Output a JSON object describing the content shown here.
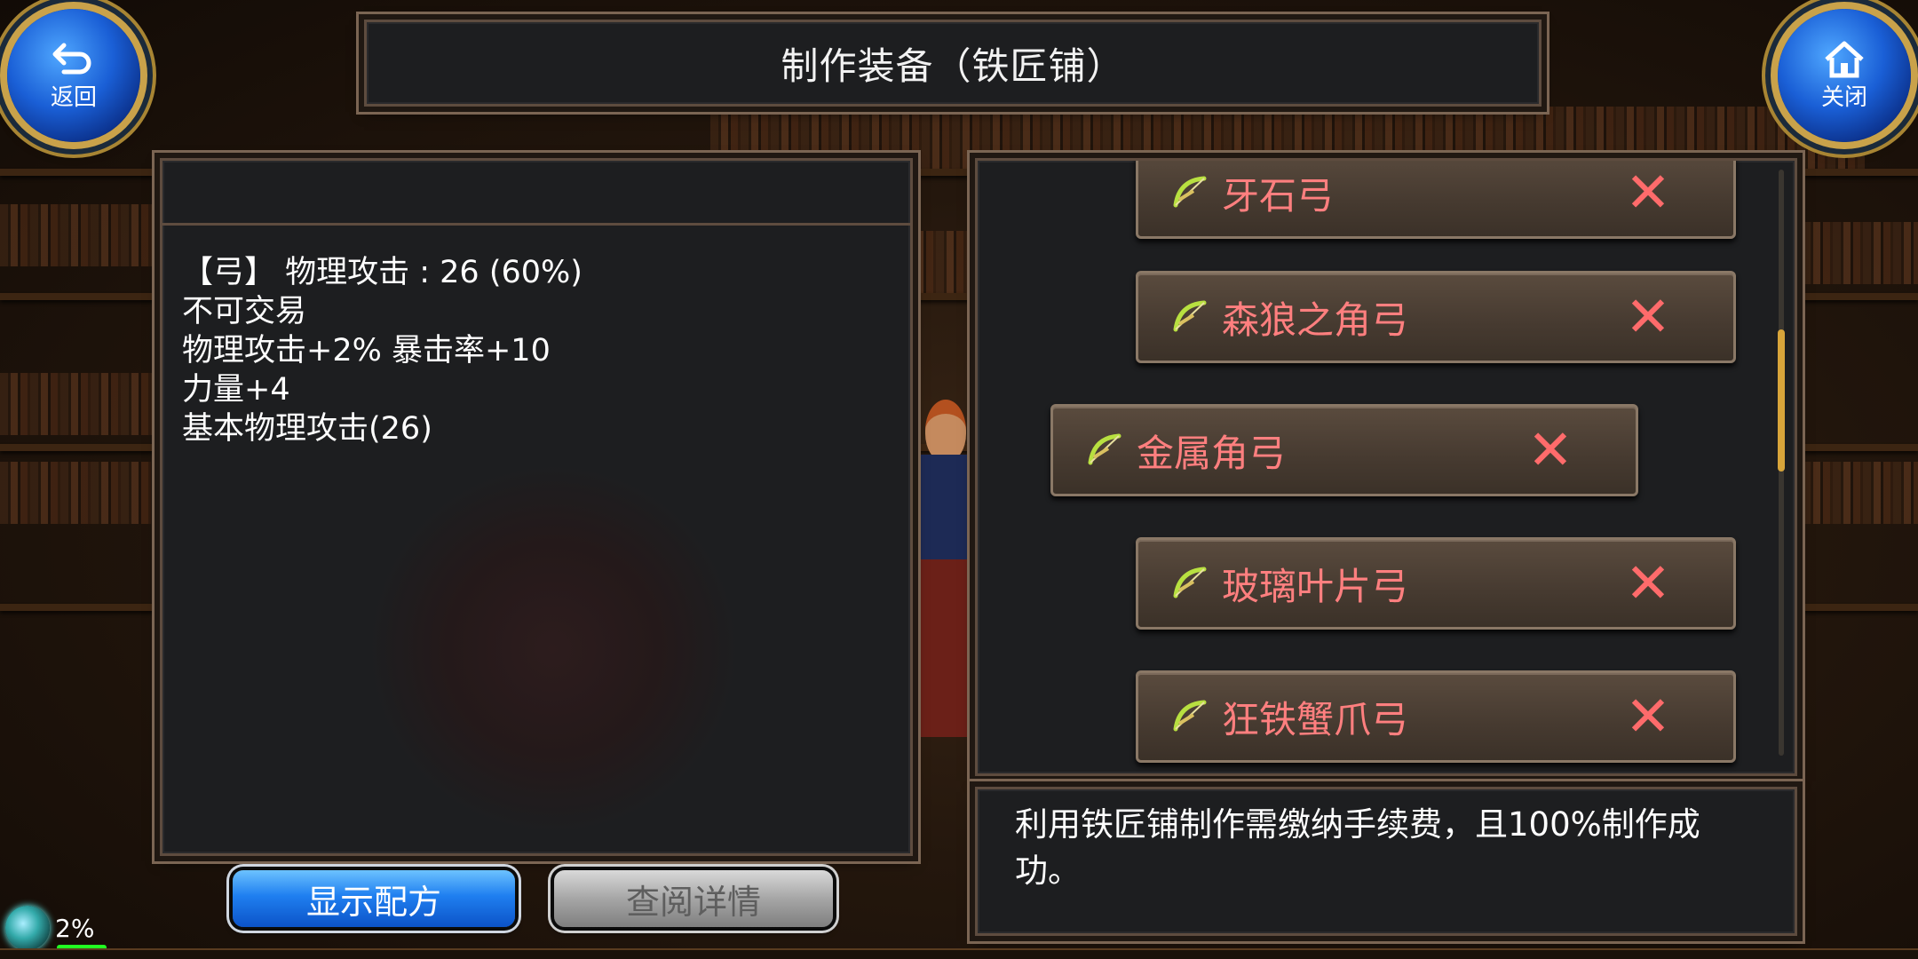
{
  "title": "制作装备（铁匠铺）",
  "buttons": {
    "back_label": "返回",
    "close_label": "关闭",
    "show_recipe": "显示配方",
    "view_detail": "查阅详情"
  },
  "item_description": {
    "line1": "【弓】 物理攻击 :  26 (60%)",
    "line2": "不可交易",
    "line3": "物理攻击+2% 暴击率+10",
    "line4": "力量+4",
    "line5": "基本物理攻击(26)"
  },
  "recipe_list": [
    {
      "name": "牙石弓",
      "selected": false
    },
    {
      "name": "森狼之角弓",
      "selected": false
    },
    {
      "name": "金属角弓",
      "selected": true
    },
    {
      "name": "玻璃叶片弓",
      "selected": false
    },
    {
      "name": "狂铁蟹爪弓",
      "selected": false
    }
  ],
  "info_text": "利用铁匠铺制作需缴纳手续费，且100%制作成功。",
  "status": {
    "percent": "2%"
  },
  "colors": {
    "item_name": "#ff7f7f",
    "blue_button": "#1f7ff0",
    "frame_border": "#5e4c3f"
  },
  "icons": {
    "back": "return-arrow-icon",
    "close": "home-icon",
    "item": "bow-icon",
    "remove": "x-mark-icon"
  }
}
